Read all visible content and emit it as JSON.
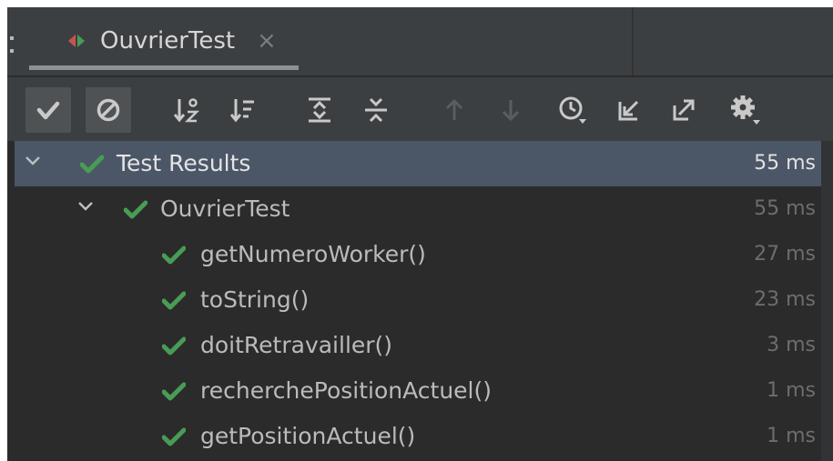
{
  "tab": {
    "title": "OuvrierTest",
    "close_glyph": "×",
    "icon": "test-class-icon"
  },
  "toolbar": {
    "buttons": [
      {
        "name": "show-passed-button",
        "icon": "check-icon",
        "pressed": true
      },
      {
        "name": "show-ignored-button",
        "icon": "ban-icon",
        "pressed": true
      },
      {
        "name": "sort-alphabetically-button",
        "icon": "sort-alpha-icon",
        "pressed": false
      },
      {
        "name": "sort-by-duration-button",
        "icon": "sort-duration-icon",
        "pressed": false
      },
      {
        "name": "expand-all-button",
        "icon": "expand-all-icon",
        "pressed": false
      },
      {
        "name": "collapse-all-button",
        "icon": "collapse-all-icon",
        "pressed": false
      },
      {
        "name": "previous-failed-button",
        "icon": "arrow-up-icon",
        "pressed": false,
        "disabled": true
      },
      {
        "name": "next-failed-button",
        "icon": "arrow-down-icon",
        "pressed": false,
        "disabled": true
      },
      {
        "name": "test-history-button",
        "icon": "clock-icon",
        "pressed": false
      },
      {
        "name": "import-tests-button",
        "icon": "import-icon",
        "pressed": false
      },
      {
        "name": "export-tests-button",
        "icon": "export-icon",
        "pressed": false
      },
      {
        "name": "settings-button",
        "icon": "gear-icon",
        "pressed": false
      }
    ]
  },
  "tree": {
    "root": {
      "label": "Test Results",
      "time": "55 ms",
      "selected": true,
      "expanded": true,
      "status": "passed"
    },
    "class": {
      "label": "OuvrierTest",
      "time": "55 ms",
      "expanded": true,
      "status": "passed"
    },
    "tests": [
      {
        "label": "getNumeroWorker()",
        "time": "27 ms",
        "status": "passed"
      },
      {
        "label": "toString()",
        "time": "23 ms",
        "status": "passed"
      },
      {
        "label": "doitRetravailler()",
        "time": "3 ms",
        "status": "passed"
      },
      {
        "label": "recherchePositionActuel()",
        "time": "1 ms",
        "status": "passed"
      },
      {
        "label": "getPositionActuel()",
        "time": "1 ms",
        "status": "passed"
      }
    ]
  },
  "colors": {
    "background": "#2b2b2b",
    "panel": "#3c3f41",
    "selection": "#4b5667",
    "pass_green": "#499c54",
    "text": "#bbbbbb",
    "muted_time": "#6d6d6d"
  }
}
